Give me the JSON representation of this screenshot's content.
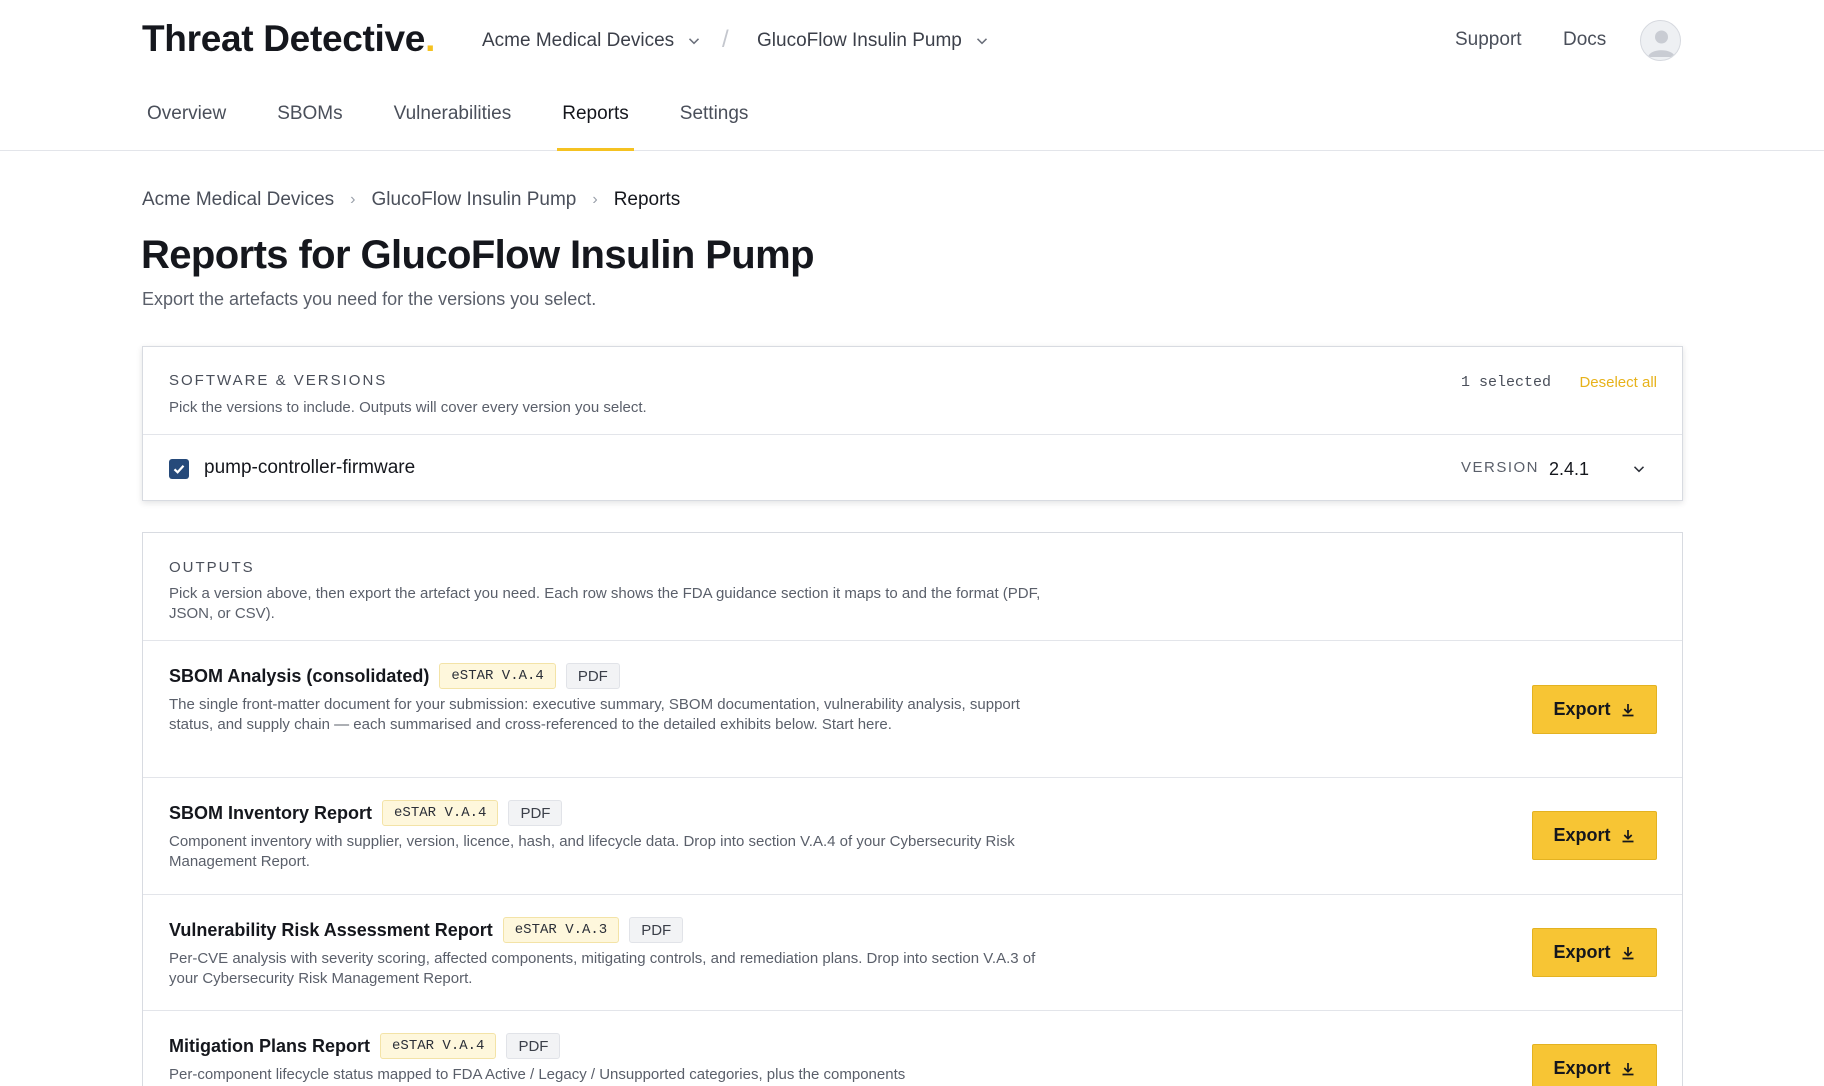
{
  "header": {
    "logo": {
      "text": "Threat Detective",
      "dot": "."
    },
    "org_switcher": "Acme Medical Devices",
    "context_separator": "/",
    "product_switcher": "GlucoFlow Insulin Pump",
    "links": {
      "support": "Support",
      "docs": "Docs"
    }
  },
  "tabs": [
    {
      "label": "Overview",
      "active": false
    },
    {
      "label": "SBOMs",
      "active": false
    },
    {
      "label": "Vulnerabilities",
      "active": false
    },
    {
      "label": "Reports",
      "active": true
    },
    {
      "label": "Settings",
      "active": false
    }
  ],
  "breadcrumb": {
    "items": [
      "Acme Medical Devices",
      "GlucoFlow Insulin Pump",
      "Reports"
    ],
    "separator": "›"
  },
  "page": {
    "title": "Reports for GlucoFlow Insulin Pump",
    "subtitle": "Export the artefacts you need for the versions you select."
  },
  "versions_card": {
    "label": "SOFTWARE & VERSIONS",
    "description": "Pick the versions to include. Outputs will cover every version you select.",
    "selected_count": "1 selected",
    "deselect_all": "Deselect all",
    "software": {
      "name": "pump-controller-firmware",
      "checked": true,
      "version_label": "VERSION",
      "version_value": "2.4.1"
    }
  },
  "outputs_card": {
    "label": "OUTPUTS",
    "description": "Pick a version above, then export the artefact you need. Each row shows the FDA guidance section it maps to and the format (PDF, JSON, or CSV).",
    "export_label": "Export",
    "rows": [
      {
        "title": "SBOM Analysis (consolidated)",
        "estar": "eSTAR V.A.4",
        "format": "PDF",
        "description": "The single front-matter document for your submission: executive summary, SBOM documentation, vulnerability analysis, support status, and supply chain — each summarised and cross-referenced to the detailed exhibits below. Start here."
      },
      {
        "title": "SBOM Inventory Report",
        "estar": "eSTAR V.A.4",
        "format": "PDF",
        "description": "Component inventory with supplier, version, licence, hash, and lifecycle data. Drop into section V.A.4 of your Cybersecurity Risk Management Report."
      },
      {
        "title": "Vulnerability Risk Assessment Report",
        "estar": "eSTAR V.A.3",
        "format": "PDF",
        "description": "Per-CVE analysis with severity scoring, affected components, mitigating controls, and remediation plans. Drop into section V.A.3 of your Cybersecurity Risk Management Report."
      },
      {
        "title": "Mitigation Plans Report",
        "estar": "eSTAR V.A.4",
        "format": "PDF",
        "description": "Per-component lifecycle status mapped to FDA Active / Legacy / Unsupported categories, plus the components"
      }
    ]
  },
  "colors": {
    "accent": "#f5c221",
    "button": "#f7c534",
    "checkbox": "#264a7a",
    "link": "#e7b21a"
  }
}
